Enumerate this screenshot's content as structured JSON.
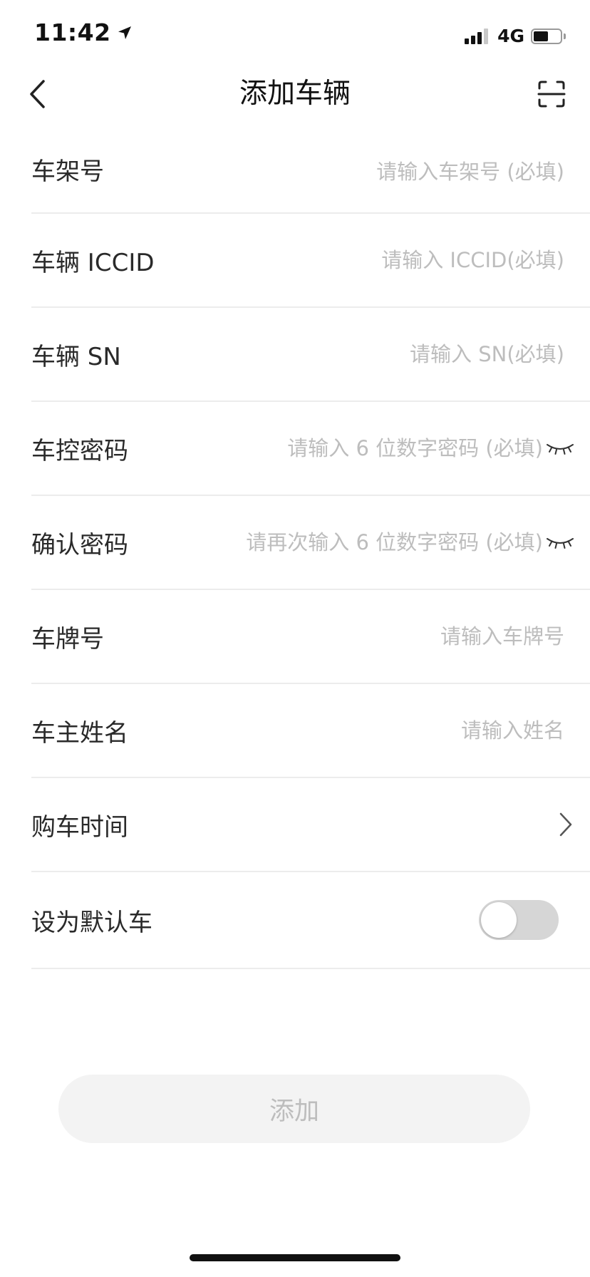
{
  "status_bar": {
    "time": "11:42",
    "network": "4G",
    "signal_bars_on": 3,
    "signal_bars_total": 4,
    "battery_level": 0.55
  },
  "nav": {
    "title": "添加车辆",
    "back_icon": "chevron-left-icon",
    "scan_icon": "scan-icon"
  },
  "form": {
    "rows": [
      {
        "label": "车架号",
        "placeholder": "请输入车架号 (必填)"
      },
      {
        "label": "车辆 ICCID",
        "placeholder": "请输入 ICCID(必填)"
      },
      {
        "label": "车辆 SN",
        "placeholder": "请输入 SN(必填)"
      },
      {
        "label": "车控密码",
        "placeholder": "请输入 6 位数字密码 (必填)"
      },
      {
        "label": "确认密码",
        "placeholder": "请再次输入 6 位数字密码 (必填)"
      },
      {
        "label": "车牌号",
        "placeholder": "请输入车牌号"
      },
      {
        "label": "车主姓名",
        "placeholder": "请输入姓名"
      },
      {
        "label": "购车时间"
      },
      {
        "label": "设为默认车",
        "toggle_on": false
      }
    ]
  },
  "submit": {
    "label": "添加"
  },
  "colors": {
    "placeholder": "#bdbdbd",
    "divider": "#ececec",
    "button_bg": "#f3f3f3",
    "toggle_off": "#d6d6d6"
  }
}
